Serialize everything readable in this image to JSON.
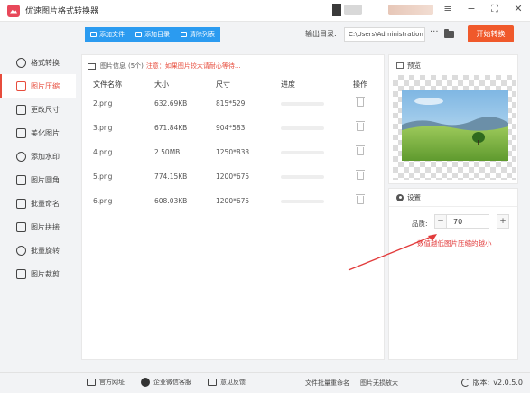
{
  "app": {
    "title": "优速图片格式转换器",
    "window_controls": [
      "≡",
      "−",
      "⛶",
      "✕"
    ]
  },
  "toolbar": {
    "add_file": "添加文件",
    "add_folder": "添加目录",
    "clear_list": "清除列表",
    "output_label": "输出目录:",
    "output_path": "C:\\Users\\Administration",
    "more": "···",
    "start": "开始转换"
  },
  "sidebar": {
    "items": [
      {
        "label": "格式转换",
        "icon": "format-icon"
      },
      {
        "label": "图片压缩",
        "icon": "compress-icon"
      },
      {
        "label": "更改尺寸",
        "icon": "resize-icon"
      },
      {
        "label": "美化图片",
        "icon": "beautify-icon"
      },
      {
        "label": "添加水印",
        "icon": "watermark-icon"
      },
      {
        "label": "图片圆角",
        "icon": "round-corner-icon"
      },
      {
        "label": "批量命名",
        "icon": "rename-icon"
      },
      {
        "label": "图片拼接",
        "icon": "stitch-icon"
      },
      {
        "label": "批量旋转",
        "icon": "rotate-icon"
      },
      {
        "label": "图片裁剪",
        "icon": "crop-icon"
      }
    ],
    "active_index": 1
  },
  "file_panel": {
    "info_label": "图片信息",
    "count": "(5个)",
    "warning": "注意：如果图片较大请耐心等待...",
    "columns": [
      "文件名称",
      "大小",
      "尺寸",
      "进度",
      "操作"
    ],
    "rows": [
      {
        "name": "2.png",
        "size": "632.69KB",
        "dim": "815*529",
        "progress": 0
      },
      {
        "name": "3.png",
        "size": "671.84KB",
        "dim": "904*583",
        "progress": 0
      },
      {
        "name": "4.png",
        "size": "2.50MB",
        "dim": "1250*833",
        "progress": 0
      },
      {
        "name": "5.png",
        "size": "774.15KB",
        "dim": "1200*675",
        "progress": 0
      },
      {
        "name": "6.png",
        "size": "608.03KB",
        "dim": "1200*675",
        "progress": 0
      }
    ]
  },
  "preview": {
    "label": "预览"
  },
  "settings": {
    "label": "设置",
    "quality_label": "品质:",
    "quality_value": "70",
    "minus": "−",
    "plus": "+",
    "annotation": "数值越低图片压缩的越小"
  },
  "footer": {
    "website": "官方网址",
    "wechat": "企业微信客服",
    "feedback": "意见反馈",
    "rename_files": "文件批量重命名",
    "lossless_zoom": "图片无损放大",
    "version_label": "版本:",
    "version": "v2.0.5.0"
  },
  "colors": {
    "accent_blue": "#2b9bf0",
    "start_orange": "#f0592b",
    "active_red": "#e74c3c",
    "annotation_red": "#e23b3b"
  }
}
